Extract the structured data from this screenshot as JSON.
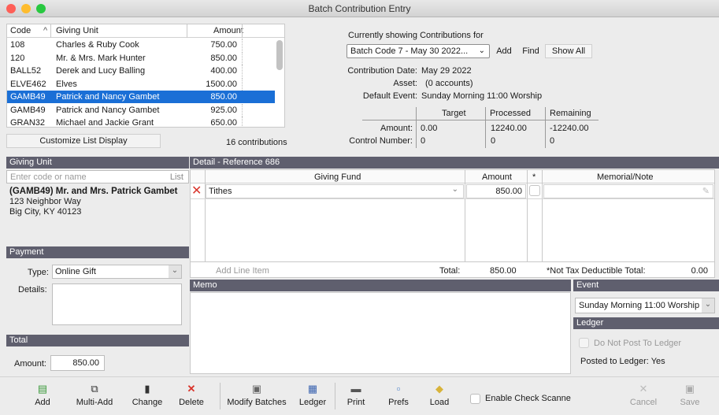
{
  "window": {
    "title": "Batch Contribution Entry"
  },
  "list": {
    "headers": {
      "code": "Code",
      "sort": "^",
      "unit": "Giving Unit",
      "amount": "Amount"
    },
    "rows": [
      {
        "code": "108",
        "unit": "Charles & Ruby Cook",
        "amount": "750.00"
      },
      {
        "code": "120",
        "unit": "Mr. & Mrs. Mark Hunter",
        "amount": "850.00"
      },
      {
        "code": "BALL52",
        "unit": "Derek and Lucy Balling",
        "amount": "400.00"
      },
      {
        "code": "ELVE462",
        "unit": "Elves",
        "amount": "1500.00"
      },
      {
        "code": "GAMB49",
        "unit": "Patrick and Nancy Gambet",
        "amount": "850.00"
      },
      {
        "code": "GAMB49",
        "unit": "Patrick and Nancy Gambet",
        "amount": "925.00"
      },
      {
        "code": "GRAN32",
        "unit": "Michael and Jackie Grant",
        "amount": "650.00"
      }
    ],
    "customize": "Customize List Display",
    "count": "16 contributions"
  },
  "batch": {
    "showing": "Currently showing Contributions for",
    "selected": "Batch Code 7 - May 30 2022...",
    "add": "Add",
    "find": "Find",
    "show_all": "Show All",
    "date_label": "Contribution Date:",
    "date": "May 29 2022",
    "asset_label": "Asset:",
    "asset": "(0 accounts)",
    "event_label": "Default Event:",
    "event": "Sunday Morning 11:00 Worship",
    "col_target": "Target",
    "col_processed": "Processed",
    "col_remaining": "Remaining",
    "amount_label": "Amount:",
    "amount_target": "0.00",
    "amount_processed": "12240.00",
    "amount_remaining": "-12240.00",
    "control_label": "Control Number:",
    "control_target": "0",
    "control_processed": "0",
    "control_remaining": "0"
  },
  "giving_unit": {
    "header": "Giving Unit",
    "placeholder": "Enter code or name",
    "list_btn": "List",
    "name": "(GAMB49) Mr. and Mrs. Patrick Gambet",
    "addr1": "123 Neighbor Way",
    "addr2": "Big City, KY  40123"
  },
  "payment": {
    "header": "Payment",
    "type_label": "Type:",
    "type": "Online Gift",
    "details_label": "Details:"
  },
  "total": {
    "header": "Total",
    "amount_label": "Amount:",
    "amount": "850.00"
  },
  "detail": {
    "header": "Detail - Reference 686",
    "col_fund": "Giving Fund",
    "col_amount": "Amount",
    "col_star": "*",
    "col_memo": "Memorial/Note",
    "line_fund": "Tithes",
    "line_amount": "850.00",
    "add_line": "Add Line Item",
    "total_label": "Total:",
    "total": "850.00",
    "ntd_label": "*Not Tax Deductible Total:",
    "ntd": "0.00"
  },
  "memo": {
    "header": "Memo"
  },
  "event": {
    "header": "Event",
    "value": "Sunday Morning 11:00 Worship"
  },
  "ledger": {
    "header": "Ledger",
    "no_post": "Do Not Post To Ledger",
    "posted": "Posted to Ledger: Yes"
  },
  "toolbar": {
    "add": "Add",
    "multi_add": "Multi-Add",
    "change": "Change",
    "delete": "Delete",
    "modify": "Modify Batches",
    "ledger": "Ledger",
    "print": "Print",
    "prefs": "Prefs",
    "load": "Load",
    "scanner": "Enable Check Scanne",
    "cancel": "Cancel",
    "save": "Save"
  },
  "colors": {
    "selection": "#1a6fd6",
    "header": "#5f5f6e",
    "close": "#fe5f57",
    "min": "#febc2e",
    "max": "#28c840",
    "delete": "#d9342b"
  }
}
